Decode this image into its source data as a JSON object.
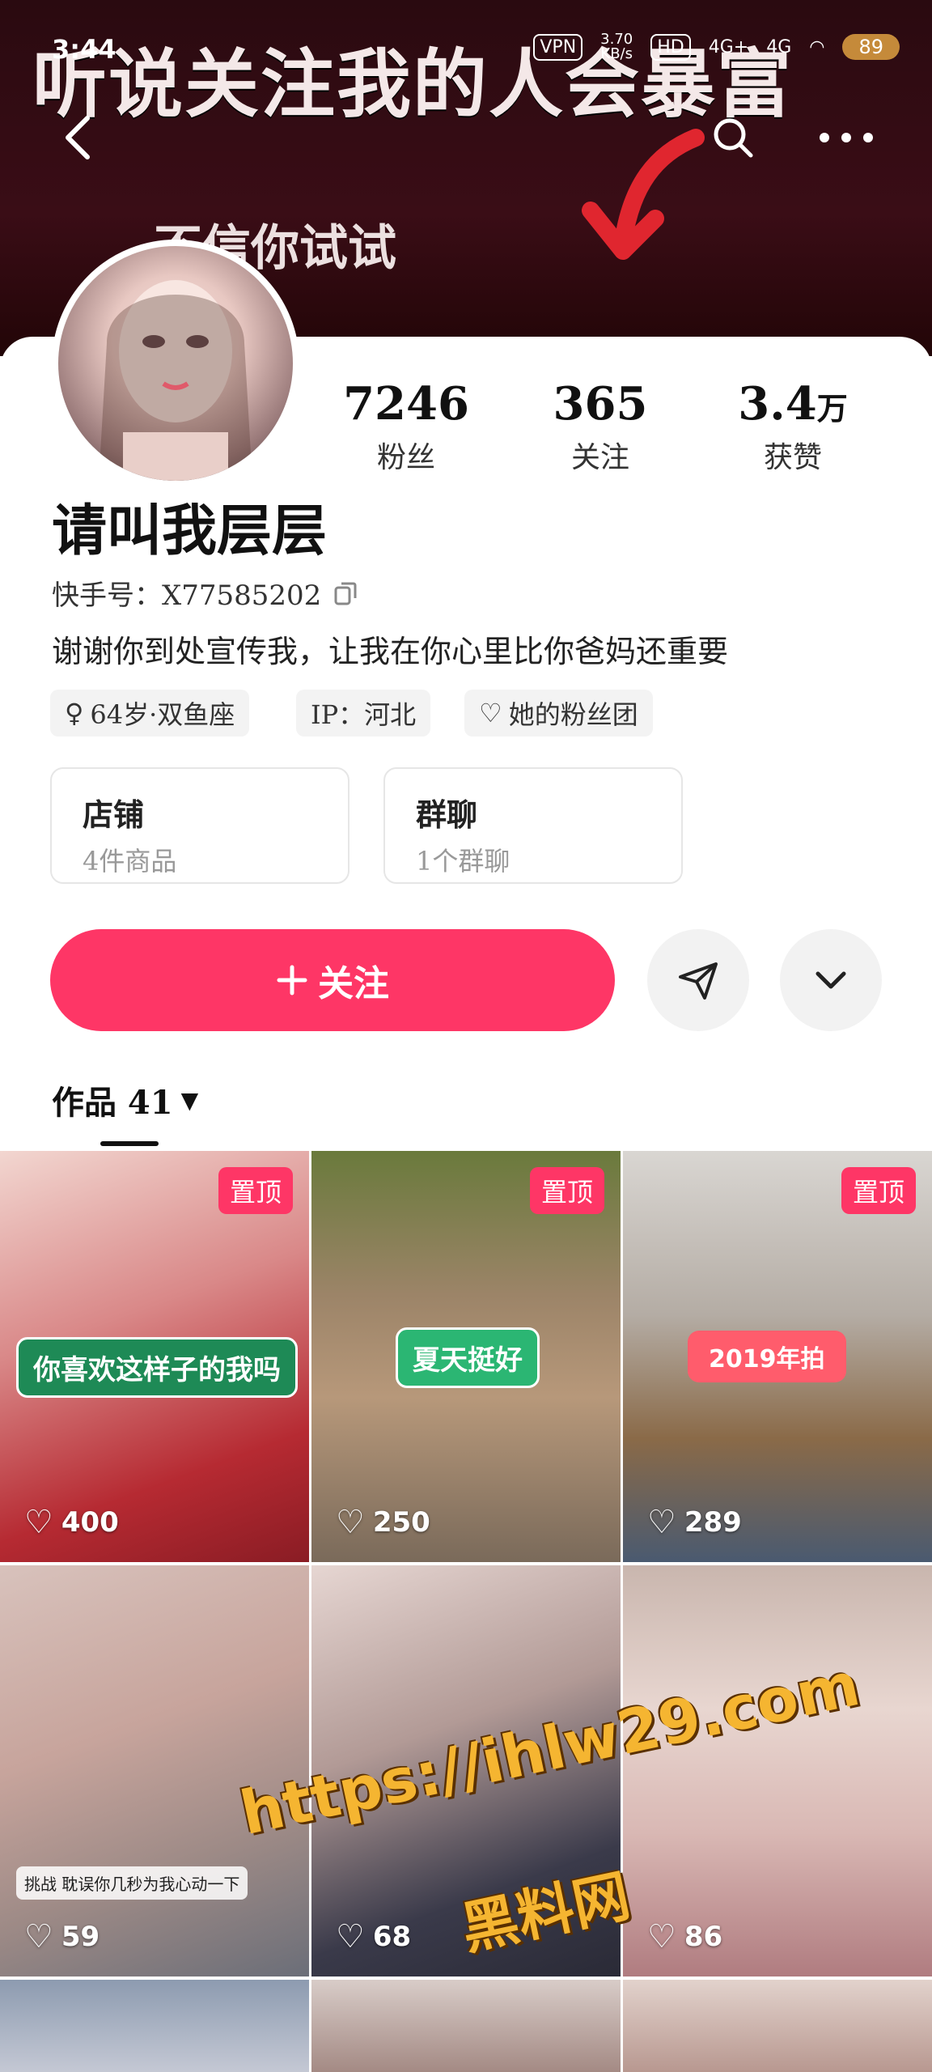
{
  "status_bar": {
    "time": "3:44",
    "vpn": "VPN",
    "speed": "3.70\nKB/s",
    "hd": "HD",
    "net1": "4G+",
    "net2": "4G",
    "battery": "89"
  },
  "banner": {
    "headline": "听说关注我的人会暴富",
    "subline": "不信你试试"
  },
  "profile": {
    "stats": [
      {
        "value": "7246",
        "unit": "",
        "label": "粉丝"
      },
      {
        "value": "365",
        "unit": "",
        "label": "关注"
      },
      {
        "value": "3.4",
        "unit": "万",
        "label": "获赞"
      }
    ],
    "nickname": "请叫我层层",
    "kuaishou_id": "快手号：X77585202",
    "bio": "谢谢你到处宣传我，让我在你心里比你爸妈还重要",
    "tags": {
      "age_sign": "64岁·双鱼座",
      "ip": "IP：河北",
      "fan_group": "她的粉丝团"
    },
    "entries": [
      {
        "title": "店铺",
        "sub": "4件商品"
      },
      {
        "title": "群聊",
        "sub": "1个群聊"
      }
    ],
    "follow_label": "关注",
    "works_label": "作品 41"
  },
  "grid": {
    "pin_label": "置顶",
    "items": [
      {
        "likes": "400",
        "caption": "你喜欢这样子的我吗"
      },
      {
        "likes": "250",
        "caption": "夏天挺好"
      },
      {
        "likes": "289",
        "caption": "2019年拍"
      },
      {
        "likes": "59",
        "caption": "挑战 耽误你几秒为我心动一下"
      },
      {
        "likes": "68",
        "caption": ""
      },
      {
        "likes": "86",
        "caption": ""
      }
    ]
  },
  "watermark": {
    "line1": "https://ihlw29.com",
    "line2": "黑料网"
  },
  "colors": {
    "accent": "#fe3666",
    "banner": "#2a0a10",
    "caption_green": "#2bb673"
  }
}
